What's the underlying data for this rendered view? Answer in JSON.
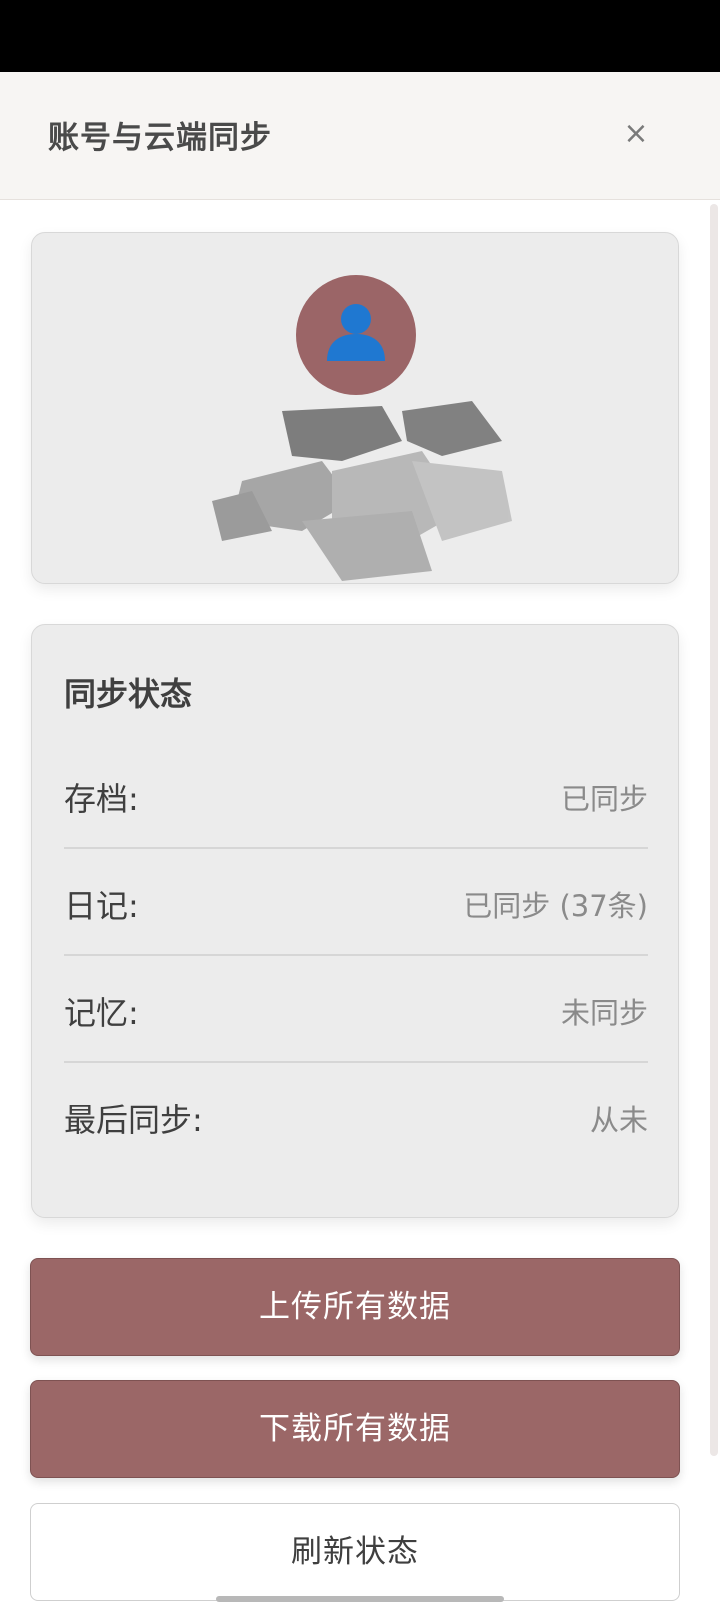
{
  "header": {
    "title": "账号与云端同步",
    "close_label": "×"
  },
  "profile": {
    "avatar_icon": "user-icon",
    "avatar_color": "#9b6567",
    "redacted": true
  },
  "sync_status": {
    "title": "同步状态",
    "rows": [
      {
        "label": "存档:",
        "value": "已同步"
      },
      {
        "label": "日记:",
        "value": "已同步 (37条)"
      },
      {
        "label": "记忆:",
        "value": "未同步"
      },
      {
        "label": "最后同步:",
        "value": "从未"
      }
    ]
  },
  "actions": {
    "upload_label": "上传所有数据",
    "download_label": "下载所有数据",
    "refresh_label": "刷新状态",
    "primary_color": "#9b6767"
  }
}
